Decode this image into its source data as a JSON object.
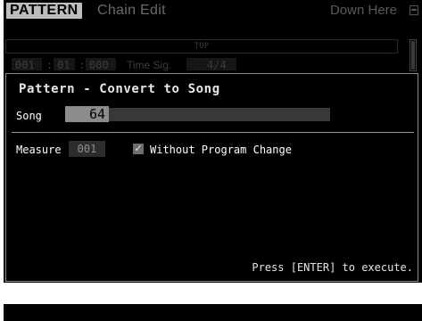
{
  "header": {
    "mode": "PATTERN",
    "title": "Chain Edit",
    "right_text": "Down Here",
    "right_icon": "window-icon"
  },
  "background": {
    "track_label": "TOP",
    "position": [
      "001",
      "01",
      "000"
    ],
    "time_sig_label": "Time Sig.",
    "time_sig_value": "4/4"
  },
  "dialog": {
    "title": "Pattern - Convert to Song",
    "song": {
      "label": "Song",
      "value": "64"
    },
    "measure": {
      "label": "Measure",
      "value": "001"
    },
    "option": {
      "checked": true,
      "label": "Without Program Change"
    },
    "hint": "Press [ENTER] to execute."
  },
  "colors": {
    "screen_bg": "#000000",
    "mode_tag_bg": "#bdbdbd",
    "value_highlight": "#8c8c8c",
    "dialog_border": "#8a8a8a"
  }
}
